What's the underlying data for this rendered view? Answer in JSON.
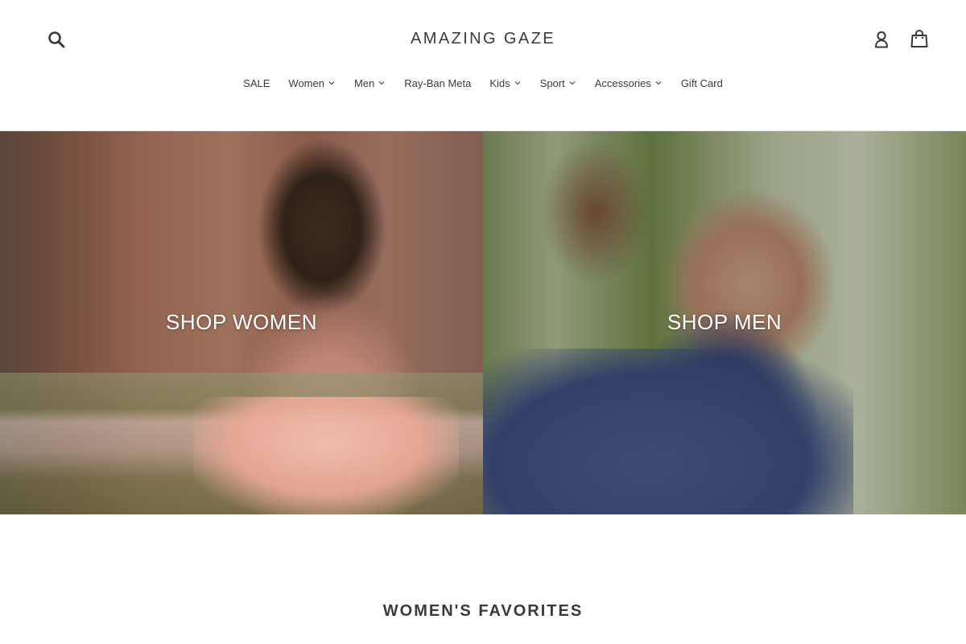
{
  "header": {
    "logo": "AMAZING GAZE",
    "icons": {
      "search": "search-icon",
      "account": "user-icon",
      "cart": "cart-icon"
    }
  },
  "nav": {
    "items": [
      {
        "label": "SALE",
        "has_dropdown": false
      },
      {
        "label": "Women",
        "has_dropdown": true
      },
      {
        "label": "Men",
        "has_dropdown": true
      },
      {
        "label": "Ray-Ban Meta",
        "has_dropdown": false
      },
      {
        "label": "Kids",
        "has_dropdown": true
      },
      {
        "label": "Sport",
        "has_dropdown": true
      },
      {
        "label": "Accessories",
        "has_dropdown": true
      },
      {
        "label": "Gift Card",
        "has_dropdown": false
      }
    ]
  },
  "hero": {
    "women": {
      "label": "SHOP WOMEN"
    },
    "men": {
      "label": "SHOP MEN"
    }
  },
  "sections": {
    "favorites_title": "WOMEN'S FAVORITES"
  },
  "colors": {
    "text": "#3a3a3a",
    "background": "#ffffff",
    "hero_text": "#ffffff"
  }
}
